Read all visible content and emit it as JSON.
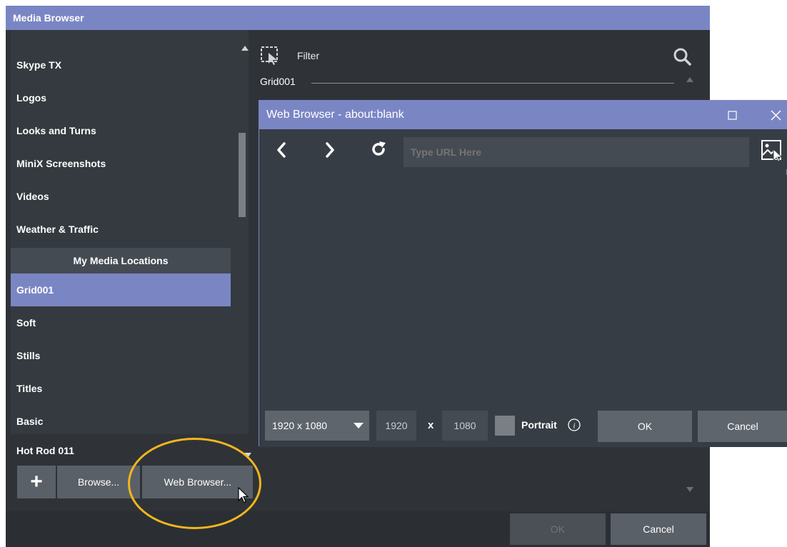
{
  "media_browser": {
    "title": "Media Browser",
    "list_items": [
      "Skype TX",
      "Logos",
      "Looks and Turns",
      "MiniX Screenshots",
      "Videos",
      "Weather & Traffic"
    ],
    "section_header": "My Media Locations",
    "location_items": [
      "Grid001",
      "Soft",
      "Stills",
      "Titles",
      "Basic",
      "Hot Rod 011"
    ],
    "selected_location": "Grid001",
    "add_button": "+",
    "browse_button": "Browse...",
    "web_browser_button": "Web Browser...",
    "filter_label": "Filter",
    "group_label": "Grid001",
    "ok_button": "OK",
    "cancel_button": "Cancel"
  },
  "web_browser": {
    "title": "Web Browser - about:blank",
    "url_placeholder": "Type URL Here",
    "resolution_selected": "1920 x 1080",
    "width": "1920",
    "x_label": "x",
    "height": "1080",
    "portrait_label": "Portrait",
    "ok_button": "OK",
    "cancel_button": "Cancel"
  },
  "colors": {
    "accent": "#7a86c4",
    "panel": "#343a40",
    "highlight": "#f2b61c"
  }
}
